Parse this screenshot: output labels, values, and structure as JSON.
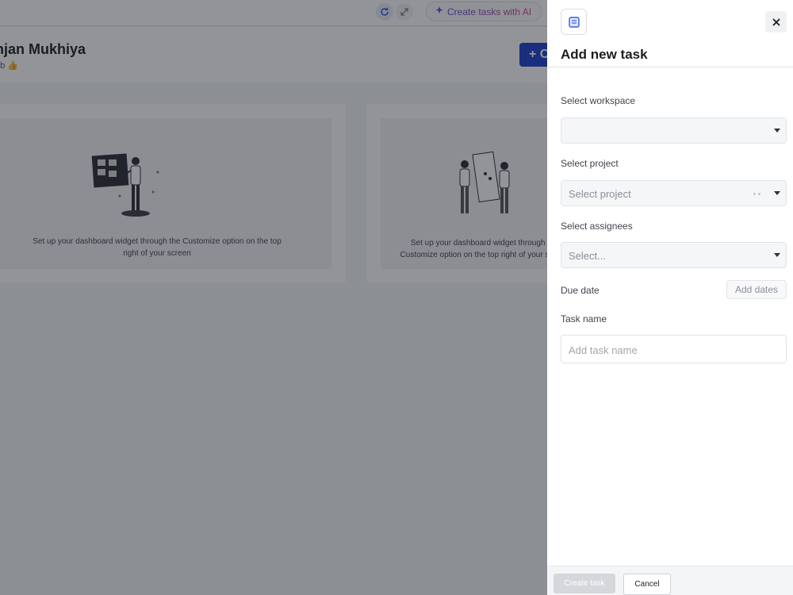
{
  "topbar": {
    "ai_button_label": "Create tasks with AI",
    "sync_icon": "sync-icon",
    "expand_icon": "expand-icon"
  },
  "header": {
    "user_name": "njan Mukhiya",
    "user_subtitle": "ob 👍",
    "create_button_label": "+ C"
  },
  "cards": [
    {
      "text": "Set up your dashboard widget through the Customize option on the top right of your screen"
    },
    {
      "text": "Set up your dashboard widget through the Customize option on the top right of your screen"
    }
  ],
  "drawer": {
    "title": "Add new task",
    "workspace": {
      "label": "Select workspace",
      "value": ""
    },
    "project": {
      "label": "Select project",
      "placeholder": "Select project"
    },
    "assignees": {
      "label": "Select assignees",
      "placeholder": "Select..."
    },
    "due_date": {
      "label": "Due date",
      "button_label": "Add dates"
    },
    "task_name": {
      "label": "Task name",
      "placeholder": "Add task name"
    },
    "footer": {
      "create_label": "Create task",
      "cancel_label": "Cancel"
    }
  },
  "colors": {
    "primary": "#1c3fcf",
    "overlay": "#181c24",
    "ai_gradient_start": "#5b4bdb",
    "ai_gradient_end": "#d6457f"
  }
}
